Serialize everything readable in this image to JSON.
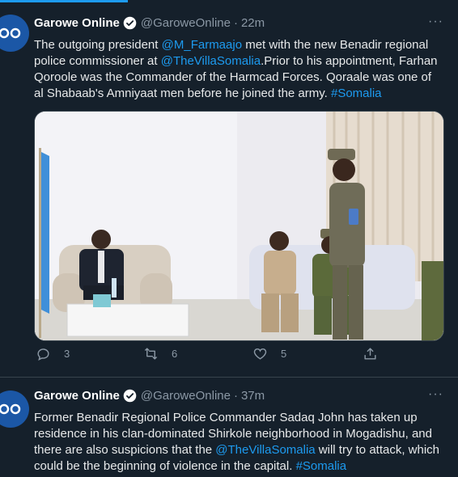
{
  "tweets": [
    {
      "author": "Garowe Online",
      "handle": "@GaroweOnline",
      "time": "22m",
      "text": {
        "p1": "The outgoing president ",
        "mention1": "@M_Farmaajo",
        "p2": " met with the new Benadir regional police commissioner at ",
        "mention2": "@TheVillaSomalia",
        "p3": ".Prior to his appointment, Farhan Qoroole was the Commander of the Harmcad Forces. Qoraale was one of al Shabaab's Amniyaat men before he joined the army. ",
        "hashtag": "#Somalia"
      },
      "replies": "3",
      "retweets": "6",
      "likes": "5"
    },
    {
      "author": "Garowe Online",
      "handle": "@GaroweOnline",
      "time": "37m",
      "text": {
        "p1": "Former Benadir Regional Police Commander Sadaq John has taken up residence in his clan-dominated Shirkole neighborhood in Mogadishu, and there are also suspicions that the ",
        "mention1": "@TheVillaSomalia",
        "p2": " will try to attack, which could be the beginning of violence in the capital. ",
        "hashtag": "#Somalia"
      }
    }
  ],
  "dot": "·",
  "more_glyph": "···",
  "icons": {
    "reply": "reply-icon",
    "retweet": "retweet-icon",
    "like": "like-icon",
    "share": "share-icon",
    "verified": "verified-badge-icon"
  },
  "colors": {
    "background": "#15202b",
    "accent": "#1d9bf0",
    "secondary_text": "#8b98a5",
    "avatar": "#1b57a6"
  }
}
